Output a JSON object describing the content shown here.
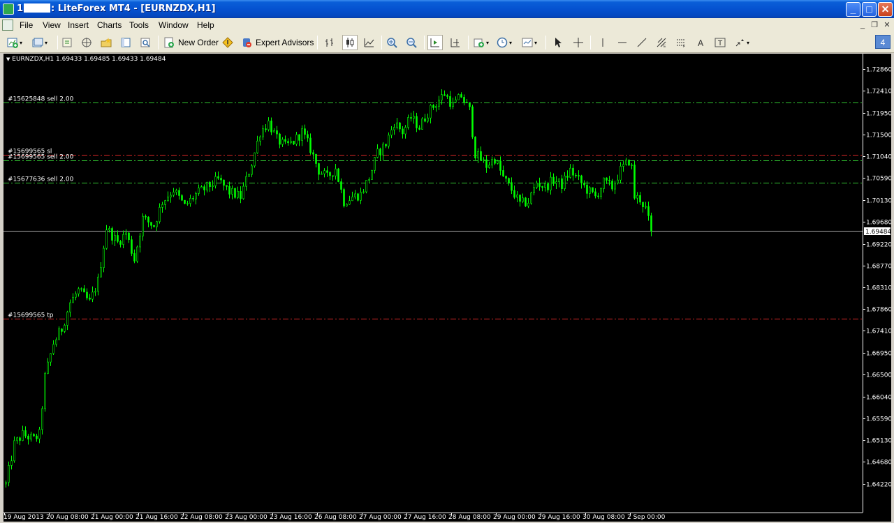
{
  "window": {
    "title_prefix": "1",
    "title_suffix": ": LiteForex MT4 - [EURNZDX,H1]",
    "badge": "4"
  },
  "menu": [
    "File",
    "View",
    "Insert",
    "Charts",
    "Tools",
    "Window",
    "Help"
  ],
  "toolbar": {
    "new_order_label": "New Order",
    "expert_advisors_label": "Expert Advisors",
    "icons": [
      "new-chart-icon",
      "profiles-icon",
      "market-watch-icon",
      "navigator-icon",
      "data-window-icon",
      "terminal-icon",
      "strategy-tester-icon",
      "new-order-icon",
      "metaeditor-icon",
      "expert-advisors-icon",
      "bar-chart-icon",
      "candlestick-icon",
      "line-chart-icon",
      "zoom-in-icon",
      "zoom-out-icon",
      "autoscroll-icon",
      "chart-shift-icon",
      "indicators-icon",
      "periods-icon",
      "templates-icon",
      "cursor-icon",
      "crosshair-icon",
      "vertical-line-icon",
      "horizontal-line-icon",
      "trendline-icon",
      "fibonacci-icon",
      "channel-icon",
      "text-icon",
      "text-label-icon",
      "arrows-icon"
    ]
  },
  "chart_data": {
    "type": "candlestick",
    "symbol_info": "EURNZDX,H1  1.69433 1.69485 1.69433 1.69484",
    "current_price": 1.69484,
    "current_price_label": "1.69484",
    "ylim": [
      1.6415,
      1.7303
    ],
    "y_ticks": [
      "1.72860",
      "1.72410",
      "1.71950",
      "1.71500",
      "1.71040",
      "1.70590",
      "1.70130",
      "1.69680",
      "1.69220",
      "1.68770",
      "1.68310",
      "1.67860",
      "1.67410",
      "1.66950",
      "1.66500",
      "1.66040",
      "1.65590",
      "1.65130",
      "1.64680",
      "1.64220"
    ],
    "x_ticks": [
      "19 Aug 2013",
      "20 Aug 08:00",
      "21 Aug 00:00",
      "21 Aug 16:00",
      "22 Aug 08:00",
      "23 Aug 00:00",
      "23 Aug 16:00",
      "26 Aug 08:00",
      "27 Aug 00:00",
      "27 Aug 16:00",
      "28 Aug 08:00",
      "29 Aug 00:00",
      "29 Aug 16:00",
      "30 Aug 08:00",
      "2 Sep 00:00"
    ],
    "x_tick_index": [
      0,
      16,
      32,
      48,
      64,
      80,
      96,
      112,
      128,
      144,
      160,
      176,
      192,
      208,
      224
    ],
    "hours_shown": 232,
    "close_path": [
      [
        0,
        1.6422
      ],
      [
        3,
        1.6505
      ],
      [
        6,
        1.6525
      ],
      [
        10,
        1.6515
      ],
      [
        12,
        1.6525
      ],
      [
        14,
        1.6645
      ],
      [
        17,
        1.6715
      ],
      [
        20,
        1.6745
      ],
      [
        23,
        1.68
      ],
      [
        26,
        1.6825
      ],
      [
        30,
        1.68
      ],
      [
        33,
        1.6845
      ],
      [
        36,
        1.6955
      ],
      [
        40,
        1.6925
      ],
      [
        43,
        1.6945
      ],
      [
        46,
        1.689
      ],
      [
        49,
        1.6975
      ],
      [
        53,
        1.696
      ],
      [
        56,
        1.701
      ],
      [
        60,
        1.7035
      ],
      [
        64,
        1.7
      ],
      [
        68,
        1.7025
      ],
      [
        72,
        1.704
      ],
      [
        76,
        1.7055
      ],
      [
        80,
        1.703
      ],
      [
        84,
        1.702
      ],
      [
        88,
        1.709
      ],
      [
        91,
        1.7155
      ],
      [
        94,
        1.7175
      ],
      [
        97,
        1.714
      ],
      [
        100,
        1.7125
      ],
      [
        103,
        1.7135
      ],
      [
        106,
        1.7155
      ],
      [
        109,
        1.712
      ],
      [
        112,
        1.7075
      ],
      [
        115,
        1.706
      ],
      [
        118,
        1.708
      ],
      [
        121,
        1.701
      ],
      [
        124,
        1.702
      ],
      [
        127,
        1.7025
      ],
      [
        130,
        1.706
      ],
      [
        133,
        1.711
      ],
      [
        136,
        1.713
      ],
      [
        139,
        1.7175
      ],
      [
        142,
        1.7155
      ],
      [
        145,
        1.7185
      ],
      [
        148,
        1.7165
      ],
      [
        151,
        1.7195
      ],
      [
        154,
        1.7215
      ],
      [
        157,
        1.7235
      ],
      [
        160,
        1.721
      ],
      [
        163,
        1.723
      ],
      [
        166,
        1.72
      ],
      [
        168,
        1.711
      ],
      [
        172,
        1.7085
      ],
      [
        175,
        1.71
      ],
      [
        178,
        1.706
      ],
      [
        181,
        1.7035
      ],
      [
        184,
        1.7005
      ],
      [
        187,
        1.701
      ],
      [
        190,
        1.705
      ],
      [
        193,
        1.704
      ],
      [
        196,
        1.7055
      ],
      [
        199,
        1.7045
      ],
      [
        202,
        1.7075
      ],
      [
        205,
        1.7055
      ],
      [
        208,
        1.7035
      ],
      [
        211,
        1.702
      ],
      [
        214,
        1.705
      ],
      [
        217,
        1.704
      ],
      [
        220,
        1.7075
      ],
      [
        223,
        1.7095
      ],
      [
        224,
        1.708
      ],
      [
        225,
        1.702
      ],
      [
        227,
        1.7015
      ],
      [
        229,
        1.6995
      ],
      [
        231,
        1.6948
      ]
    ],
    "levels": [
      {
        "label": "#15625848 sell 2.00",
        "price": 1.7217,
        "color": "#32c832",
        "style": "dashdot"
      },
      {
        "label": "#15699565 sl",
        "price": 1.71075,
        "color": "#dc2828",
        "style": "dashdot"
      },
      {
        "label": "#15699565 sell 2.00",
        "price": 1.70955,
        "color": "#32c832",
        "style": "dashdot"
      },
      {
        "label": "#15677636 sell 2.00",
        "price": 1.70495,
        "color": "#32c832",
        "style": "dashdot"
      },
      {
        "label": "#15699565 tp",
        "price": 1.67655,
        "color": "#dc2828",
        "style": "dashdot"
      }
    ],
    "colors": {
      "background": "#000000",
      "candles": "#00ff00",
      "axis_text": "#ffffff",
      "bid_line": "#a9a9a9",
      "price_box_bg": "#ffffff",
      "price_box_text": "#000000"
    },
    "grid": false
  }
}
